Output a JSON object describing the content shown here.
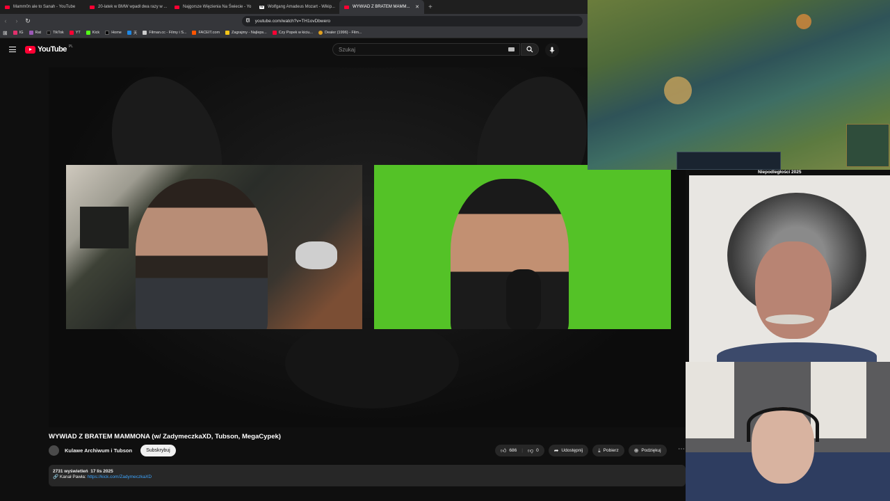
{
  "tabs": [
    {
      "title": "Mamm0n ale to Sanah - YouTube",
      "active": false
    },
    {
      "title": "20-latek w BMW wpadł dwa razy w ...",
      "active": false
    },
    {
      "title": "Najgorsze Więzienia Na Świecie - Yo",
      "active": false
    },
    {
      "title": "Wolfgang Amadeus Mozart - Wikip...",
      "active": false
    },
    {
      "title": "WYWIAD Z BRATEM MAMM...",
      "active": true
    }
  ],
  "browser": {
    "url": "youtube.com/watch?v=TH1ovDbwero",
    "bookmarks": [
      "IG",
      "Rat",
      "TikTok",
      "YT",
      "Kick",
      "Home",
      "天",
      "Filman.cc - Filmy i S...",
      "FACEIT.com",
      "Zagrajmy - Najleps...",
      "Czy Popek w kiciu...",
      "Dealer (1996) - Film..."
    ]
  },
  "youtube": {
    "logo_text": "YouTube",
    "region": "PL",
    "search_placeholder": "Szukaj"
  },
  "video": {
    "title": "WYWIAD Z BRATEM MAMMONA (w/ ZadymeczkaXD, Tubson, MegaCypek)",
    "channel": "Kulawe Archiwum i Tubson",
    "subscribe_label": "Subskrybuj",
    "likes": "686",
    "dislikes": "0",
    "share_label": "Udostępnij",
    "download_label": "Pobierz",
    "thanks_label": "Podziękuj",
    "views": "2731 wyświetleń",
    "date": "17 lis 2025",
    "desc_prefix": "🔗 Kanał Pawła:",
    "desc_link": "https://kick.com/ZadymeczkaXD"
  },
  "overlay": {
    "game_banner": "Niepodległości 2025"
  },
  "colors": {
    "brand": "#ff0033",
    "green_screen": "#54c227",
    "link": "#3ea6ff"
  }
}
